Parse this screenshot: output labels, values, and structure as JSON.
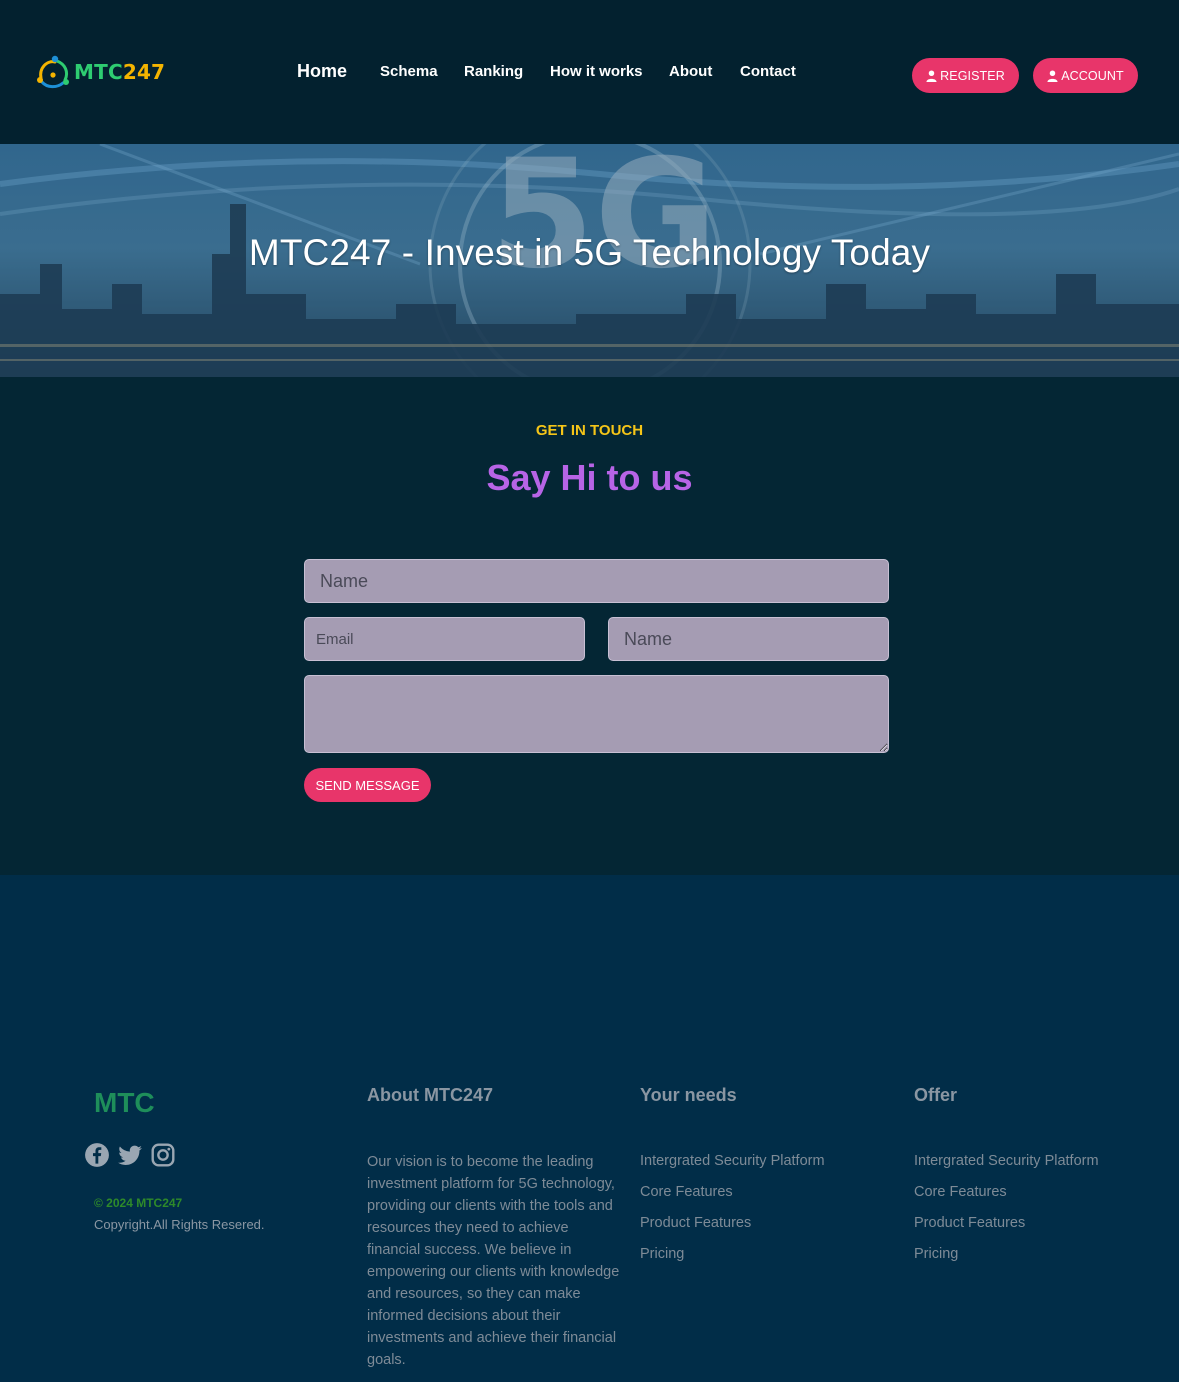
{
  "header": {
    "logo": {
      "part1": "MTC",
      "part2": "247"
    },
    "nav": [
      {
        "label": "Home"
      },
      {
        "label": "Schema"
      },
      {
        "label": "Ranking"
      },
      {
        "label": "How it works"
      },
      {
        "label": "About"
      },
      {
        "label": "Contact"
      }
    ],
    "register_label": "REGISTER",
    "account_label": "ACCOUNT"
  },
  "hero": {
    "title": "MTC247 - Invest in 5G Technology Today",
    "background_text": "5G"
  },
  "contact": {
    "eyebrow": "GET IN TOUCH",
    "heading": "Say Hi to us",
    "name_placeholder": "Name",
    "email_placeholder": "Email",
    "name2_placeholder": "Name",
    "message_placeholder": "",
    "send_label": "SEND MESSAGE"
  },
  "footer": {
    "brand": "MTC",
    "socials": [
      "facebook-icon",
      "twitter-icon",
      "instagram-icon"
    ],
    "copyright": "© 2024 MTC247",
    "rights": "Copyright.All Rights Resered.",
    "about_title": "About MTC247",
    "about_text": "Our vision is to become the leading investment platform for 5G technology, providing our clients with the tools and resources they need to achieve financial success. We believe in empowering our clients with knowledge and resources, so they can make informed decisions about their investments and achieve their financial goals.",
    "needs_title": "Your needs",
    "needs_links": [
      "Intergrated Security Platform",
      "Core Features",
      "Product Features",
      "Pricing"
    ],
    "offer_title": "Offer",
    "offer_links": [
      "Intergrated Security Platform",
      "Core Features",
      "Product Features",
      "Pricing"
    ]
  },
  "colors": {
    "header_bg": "#03212f",
    "contact_bg": "#042634",
    "footer_bg": "#012d48",
    "accent_pink": "#e8356a",
    "eyebrow_yellow": "#f5c518",
    "heading_purple": "#b764e6",
    "brand_green": "#1e8e5a"
  }
}
